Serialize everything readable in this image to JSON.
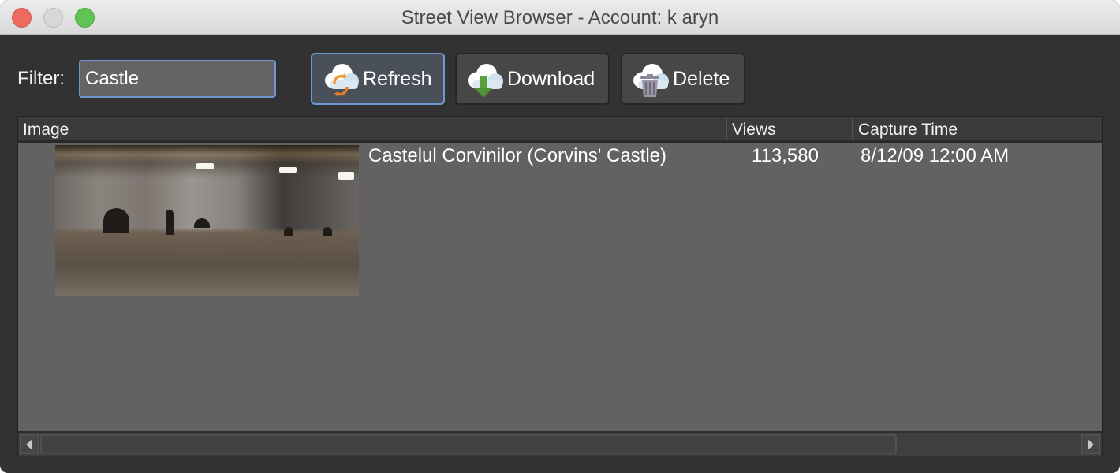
{
  "window": {
    "title": "Street View Browser - Account: k aryn"
  },
  "toolbar": {
    "filter_label": "Filter:",
    "filter_value": "Castle",
    "buttons": [
      {
        "label": "Refresh",
        "icon": "cloud-refresh-icon"
      },
      {
        "label": "Download",
        "icon": "cloud-download-icon"
      },
      {
        "label": "Delete",
        "icon": "cloud-delete-icon"
      }
    ]
  },
  "table": {
    "columns": [
      "Image",
      "Views",
      "Capture Time"
    ],
    "rows": [
      {
        "image": "castle-panorama-thumbnail",
        "name": "Castelul Corvinilor (Corvins' Castle)",
        "views": "113,580",
        "capture_time": "8/12/09 12:00 AM"
      }
    ]
  },
  "colors": {
    "accent": "#6d98d1",
    "window_bg": "#323232",
    "table_bg": "#626262",
    "close": "#ee6a5f",
    "maximize": "#5fc454"
  }
}
